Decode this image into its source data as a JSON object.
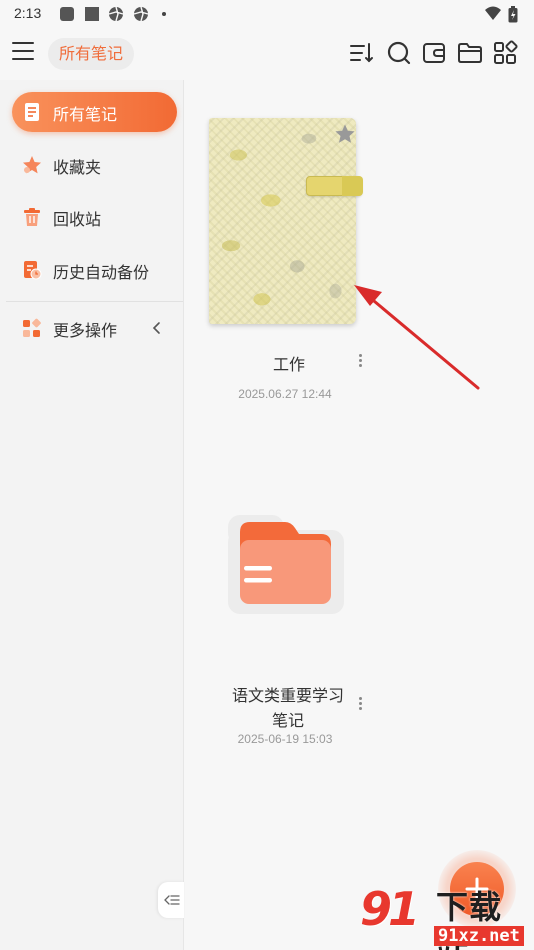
{
  "status_bar": {
    "time": "2:13"
  },
  "toolbar": {
    "title": "所有笔记"
  },
  "sidebar": {
    "items": [
      {
        "label": "所有笔记",
        "icon": "notebook-icon",
        "active": true
      },
      {
        "label": "收藏夹",
        "icon": "star-icon",
        "active": false
      },
      {
        "label": "回收站",
        "icon": "trash-icon",
        "active": false
      },
      {
        "label": "历史自动备份",
        "icon": "backup-icon",
        "active": false
      },
      {
        "label": "更多操作",
        "icon": "grid-icon",
        "active": false
      }
    ]
  },
  "notes": [
    {
      "title": "工作",
      "date": "2025.06.27 12:44",
      "type": "notebook"
    },
    {
      "title_line1": "语文类重要学习",
      "title_line2": "笔记",
      "date": "2025-06-19 15:03",
      "type": "folder"
    }
  ],
  "colors": {
    "accent": "#f26a34",
    "folder": "#f8987a",
    "folder_tab": "#f36a3a"
  },
  "watermark": {
    "logo_text": "91",
    "site_name": "下载站",
    "domain": "91xz.net"
  }
}
